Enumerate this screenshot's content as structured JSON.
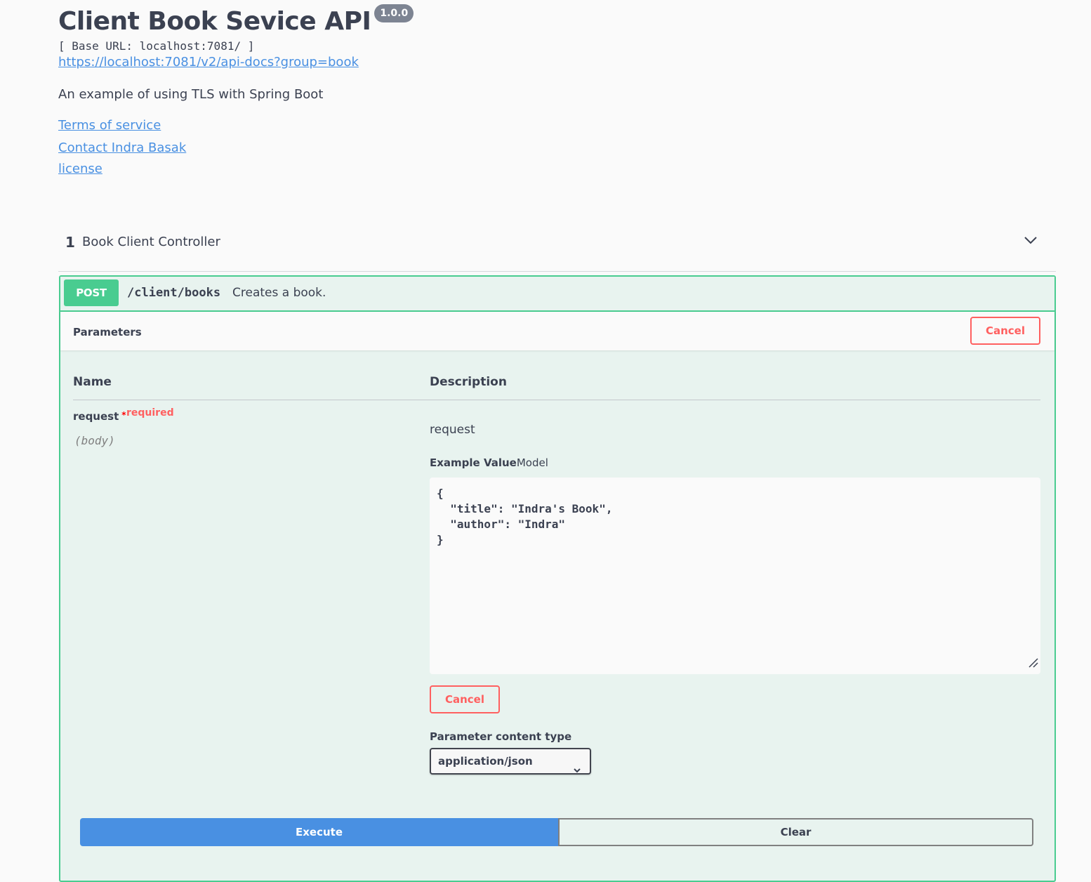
{
  "info": {
    "title": "Client Book Sevice API",
    "version": "1.0.0",
    "base_url": "[ Base URL: localhost:7081/ ]",
    "api_docs_url": "https://localhost:7081/v2/api-docs?group=book",
    "description": "An example of using TLS with Spring Boot",
    "links": {
      "terms": "Terms of service",
      "contact": "Contact Indra Basak",
      "license": "license"
    }
  },
  "tag": {
    "number": "1",
    "name": "Book Client Controller",
    "icon": "chevron-down-icon"
  },
  "operation": {
    "method": "POST",
    "path": "/client/books",
    "summary": "Creates a book.",
    "colors": {
      "method": "#49cc90",
      "border": "#49cc90",
      "background": "#e8f3ef"
    }
  },
  "parameters": {
    "title": "Parameters",
    "cancel_label": "Cancel",
    "columns": {
      "name": "Name",
      "description": "Description"
    },
    "param": {
      "name": "request",
      "required_star": "*",
      "required_label": "required",
      "in": "(body)",
      "description": "request",
      "example_value_tab": "Example Value",
      "model_tab": "Model",
      "body_value": "{\n  \"title\": \"Indra's Book\",\n  \"author\": \"Indra\"\n}"
    },
    "body_cancel_label": "Cancel",
    "content_type_label": "Parameter content type",
    "content_type_value": "application/json"
  },
  "actions": {
    "execute_label": "Execute",
    "clear_label": "Clear",
    "colors": {
      "execute": "#4990e2",
      "cancel": "#ff6060"
    }
  }
}
